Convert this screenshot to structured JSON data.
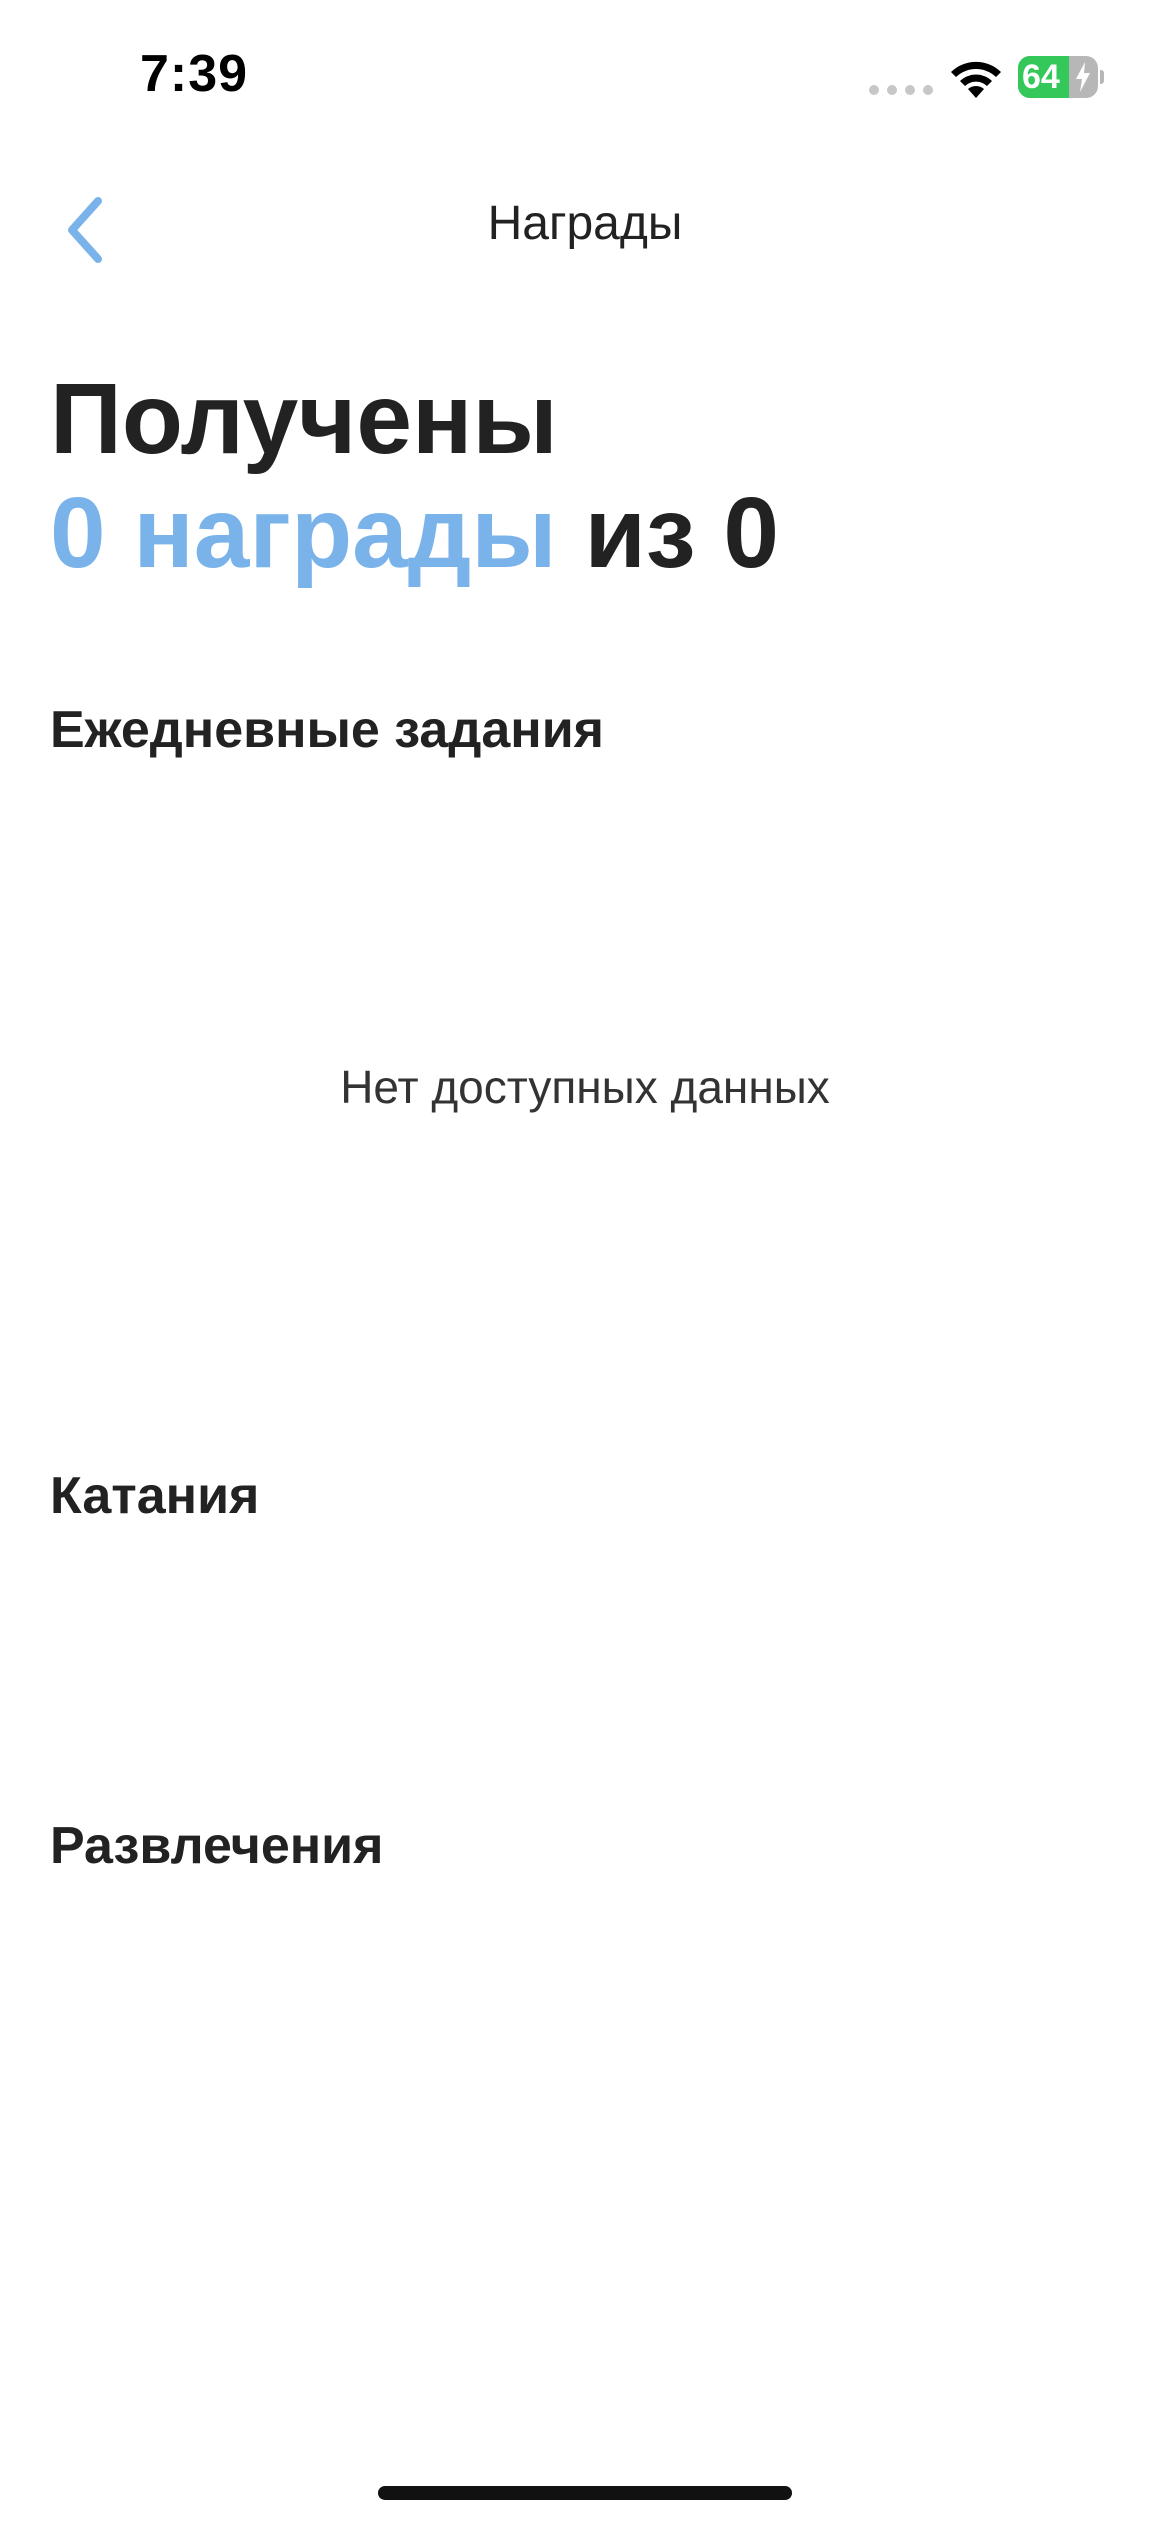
{
  "status_bar": {
    "time": "7:39",
    "battery_level": "64",
    "battery_fraction": 0.64,
    "icons": [
      "signal-icon",
      "wifi-icon",
      "battery-charging-icon"
    ]
  },
  "nav": {
    "back_icon": "chevron-left-icon",
    "title": "Награды"
  },
  "heading": {
    "line1": "Получены",
    "count_text": "0 награды",
    "suffix_text": "из 0"
  },
  "sections": {
    "daily": {
      "title": "Ежедневные задания",
      "empty_text": "Нет доступных данных"
    },
    "rides": {
      "title": "Катания"
    },
    "entertainment": {
      "title": "Развлечения"
    }
  },
  "colors": {
    "accent": "#7ab3ea",
    "text": "#222222",
    "battery_green": "#34c759"
  }
}
